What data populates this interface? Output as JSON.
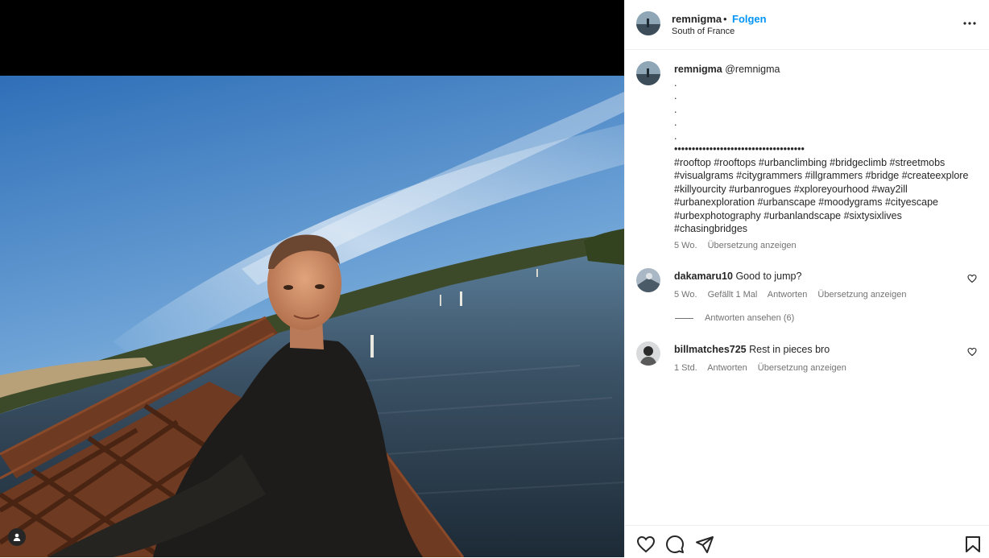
{
  "post": {
    "username": "remnigma",
    "follow_label": "Folgen",
    "location": "South of France"
  },
  "caption": {
    "username": "remnigma",
    "mention": "@remnigma",
    "dots": [
      ".",
      ".",
      ".",
      ".",
      "."
    ],
    "bullet_line": "•••••••••••••••••••••••••••••••••••••",
    "hashtags": [
      "#rooftop #rooftops #urbanclimbing #bridgeclimb #streetmobs",
      "#visualgrams #citygrammers #illgrammers #bridge #createexplore",
      "#killyourcity #urbanrogues #xploreyourhood #way2ill",
      "#urbanexploration #urbanscape #moodygrams #cityescape",
      "#urbexphotography #urbanlandscape #sixtysixlives",
      "#chasingbridges"
    ],
    "time": "5 Wo.",
    "translate": "Übersetzung anzeigen"
  },
  "comments": [
    {
      "username": "dakamaru10",
      "text": "Good to jump?",
      "time": "5 Wo.",
      "likes": "Gefällt 1 Mal",
      "reply": "Antworten",
      "translate": "Übersetzung anzeigen"
    },
    {
      "username": "billmatches725",
      "text": "Rest in pieces bro",
      "time": "1 Std.",
      "reply": "Antworten",
      "translate": "Übersetzung anzeigen"
    }
  ],
  "view_replies": "Antworten ansehen (6)",
  "icons": {
    "more": "more-horizontal-icon",
    "like": "heart-icon",
    "comment": "comment-icon",
    "share": "share-icon",
    "save": "bookmark-icon",
    "tag": "user-tag-icon"
  },
  "colors": {
    "accent": "#0095f6",
    "text": "#262626",
    "secondary": "#737373"
  }
}
